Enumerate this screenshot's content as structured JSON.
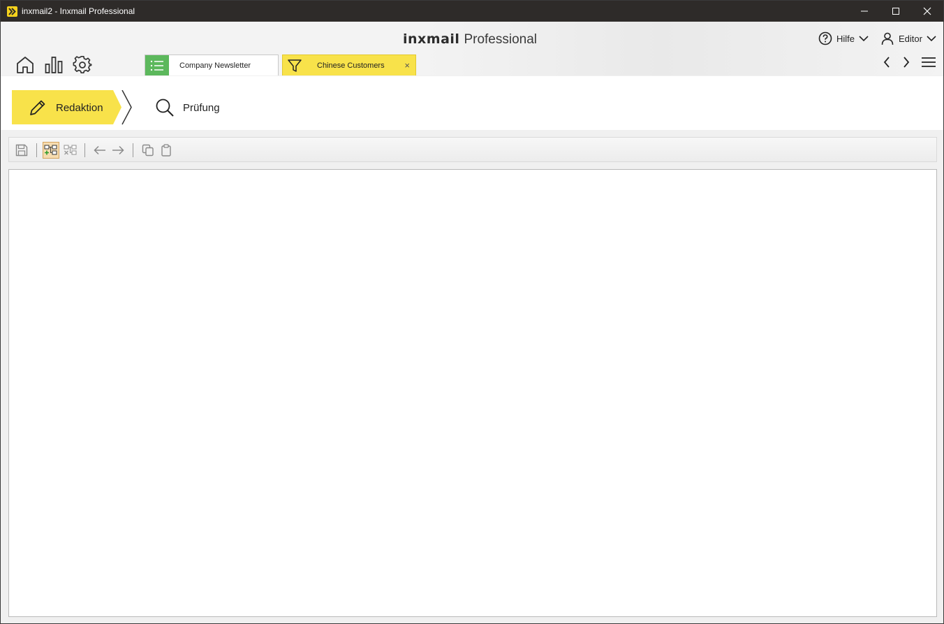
{
  "window": {
    "title": "inxmail2 - Inxmail Professional",
    "controls": [
      "minimize-icon",
      "maximize-icon",
      "close-icon"
    ]
  },
  "header": {
    "brand_logo": "inxmail",
    "brand_product": "Professional",
    "help_label": "Hilfe",
    "user_label": "Editor",
    "nav_icons": [
      "home-icon",
      "reports-icon",
      "settings-icon"
    ],
    "right_icons": [
      "back-arrow-icon",
      "forward-arrow-icon",
      "menu-icon"
    ]
  },
  "tabs": [
    {
      "label": "Company Newsletter",
      "icon": "list-icon",
      "accent": "#5cb85c",
      "active": false
    },
    {
      "label": "Chinese Customers",
      "icon": "filter-icon",
      "accent": "#f8e24a",
      "active": true,
      "close": "×"
    }
  ],
  "workflow": {
    "steps": [
      {
        "label": "Redaktion",
        "icon": "pencil-icon",
        "active": true
      },
      {
        "label": "Prüfung",
        "icon": "search-icon",
        "active": false
      }
    ],
    "active_color": "#f8e24a"
  },
  "toolbar": {
    "buttons": [
      "save-icon",
      "add-condition-icon",
      "remove-condition-icon",
      "undo-icon",
      "redo-icon",
      "copy-icon",
      "paste-icon"
    ]
  }
}
